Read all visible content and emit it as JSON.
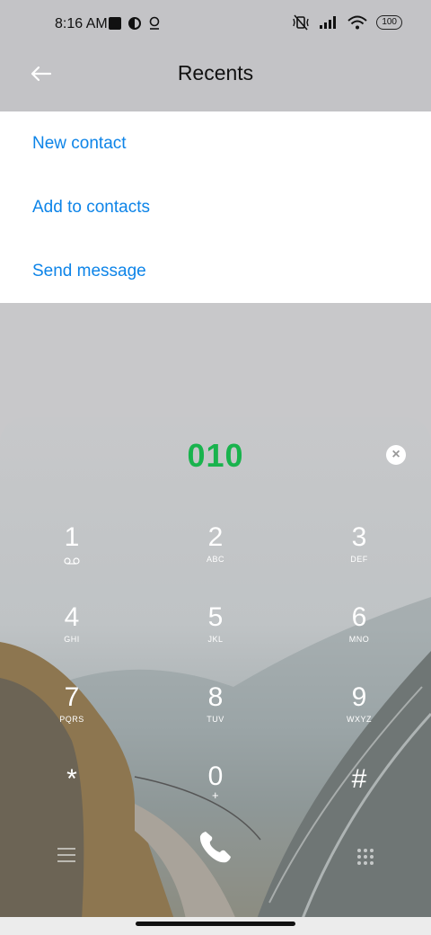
{
  "status": {
    "time": "8:16 AM",
    "battery": "100"
  },
  "header": {
    "title": "Recents"
  },
  "menu": {
    "items": [
      {
        "label": "New contact"
      },
      {
        "label": "Add to contacts"
      },
      {
        "label": "Send message"
      }
    ]
  },
  "dialer": {
    "number": "010",
    "keys": [
      {
        "digit": "1",
        "letters": ""
      },
      {
        "digit": "2",
        "letters": "ABC"
      },
      {
        "digit": "3",
        "letters": "DEF"
      },
      {
        "digit": "4",
        "letters": "GHI"
      },
      {
        "digit": "5",
        "letters": "JKL"
      },
      {
        "digit": "6",
        "letters": "MNO"
      },
      {
        "digit": "7",
        "letters": "PQRS"
      },
      {
        "digit": "8",
        "letters": "TUV"
      },
      {
        "digit": "9",
        "letters": "WXYZ"
      },
      {
        "digit": "*",
        "letters": ""
      },
      {
        "digit": "0",
        "letters": "+"
      },
      {
        "digit": "#",
        "letters": ""
      }
    ]
  },
  "colors": {
    "accent": "#0d84e8",
    "number": "#19b34d"
  }
}
